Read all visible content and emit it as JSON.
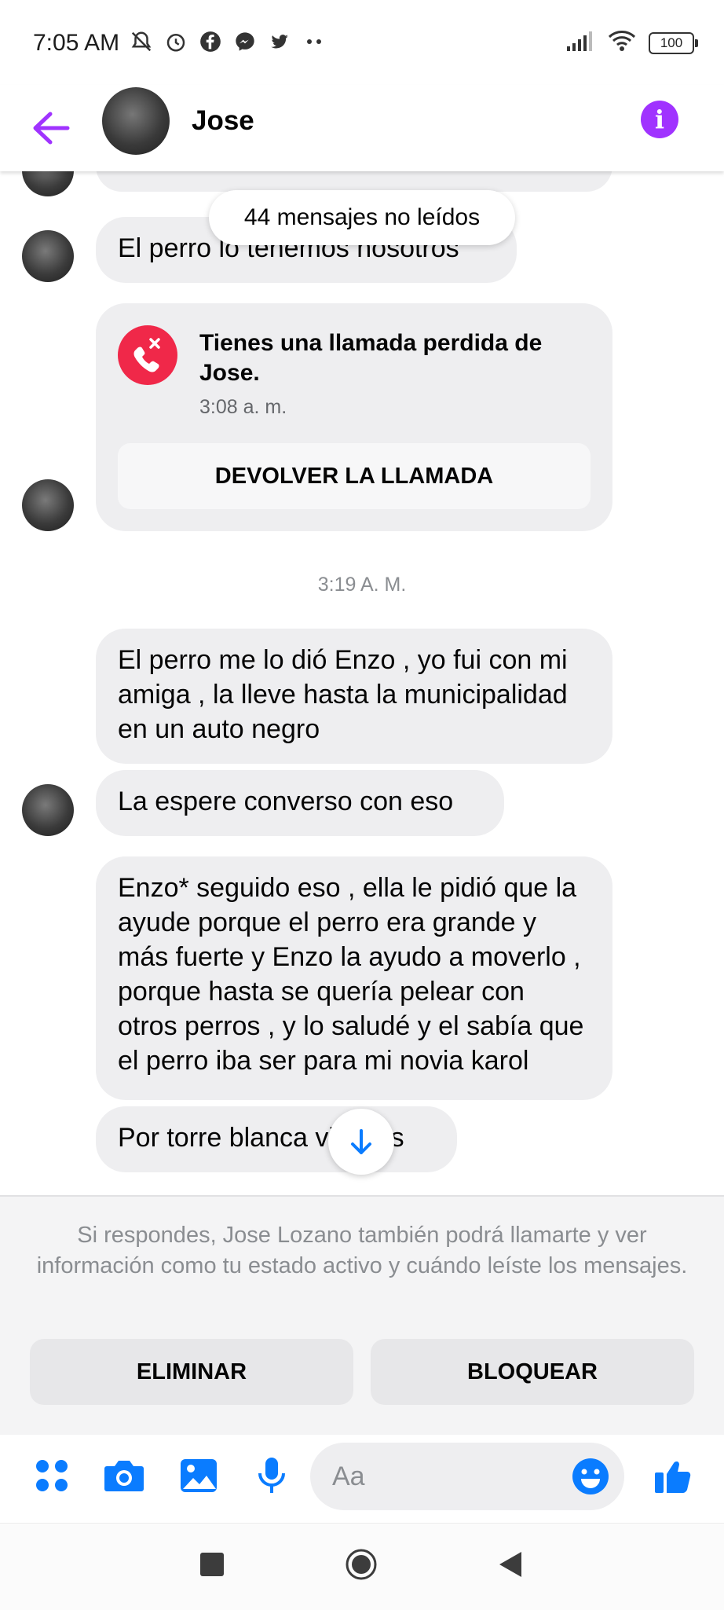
{
  "status_bar": {
    "time": "7:05 AM",
    "battery": "100"
  },
  "header": {
    "name": "Jose"
  },
  "unread_pill": "44 mensajes no leídos",
  "messages": {
    "m0_text": "El perro lo tenemos nosotros",
    "m2": "El perro me lo dió Enzo , yo fui con mi amiga , la lleve hasta la municipalidad en un auto negro",
    "m3": "La espere converso con eso",
    "m4": "Enzo* seguido eso , ella le pidió que la ayude porque el perro era grande y más fuerte y Enzo la ayudo a moverlo , porque hasta se quería pelear con otros perros , y lo saludé y el sabía que el perro iba ser para mi novia karol",
    "m5": "Por torre blanca vivimos"
  },
  "missed_call": {
    "title": "Tienes una llamada perdida de Jose.",
    "time": "3:08 a. m.",
    "button": "DEVOLVER LA LLAMADA"
  },
  "timestamp": "3:19 A. M.",
  "notice": {
    "text": "Si respondes, Jose Lozano también podrá llamarte y ver información como tu estado activo y cuándo leíste los mensajes.",
    "delete_label": "ELIMINAR",
    "block_label": "BLOQUEAR"
  },
  "composer": {
    "placeholder": "Aa"
  },
  "colors": {
    "accent_purple": "#a033ff",
    "messenger_blue": "#0a7cff",
    "missed_red": "#f02849"
  }
}
